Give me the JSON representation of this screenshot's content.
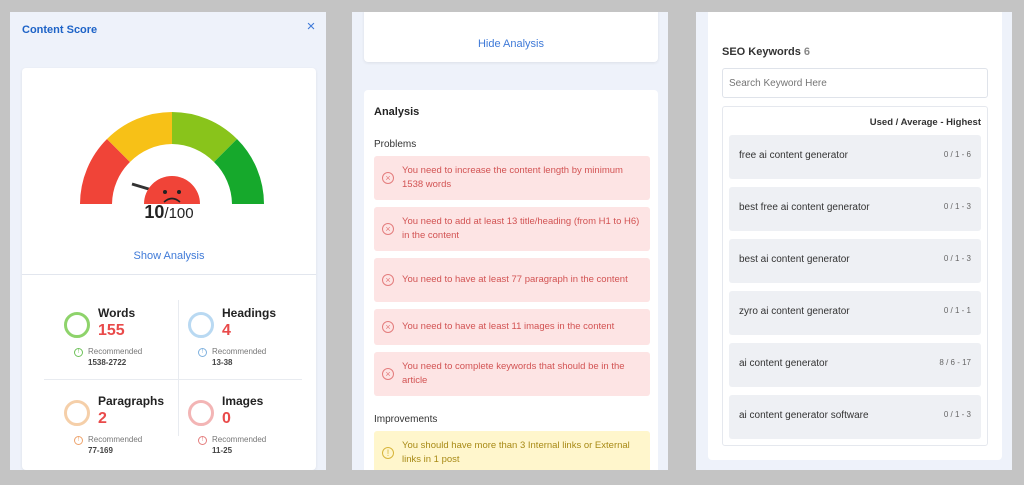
{
  "content_score": {
    "title": "Content Score",
    "close_icon": "×",
    "score": "10",
    "score_max": "/100",
    "score_fraction": 0.1,
    "face_icon": "sad-face",
    "show_analysis": "Show Analysis",
    "stats": [
      {
        "name": "Words",
        "value": "155",
        "recommended_label": "Recommended",
        "range": "1538-2722",
        "color": "#8ed36b"
      },
      {
        "name": "Headings",
        "value": "4",
        "recommended_label": "Recommended",
        "range": "13-38",
        "color": "#b9d9f2"
      },
      {
        "name": "Paragraphs",
        "value": "2",
        "recommended_label": "Recommended",
        "range": "77-169",
        "color": "#f5cfa9"
      },
      {
        "name": "Images",
        "value": "0",
        "recommended_label": "Recommended",
        "range": "11-25",
        "color": "#f3b5b5"
      }
    ],
    "colors": {
      "red": "#f04438",
      "orange": "#f7c117",
      "green_light": "#89c41b",
      "green": "#16a92c"
    }
  },
  "analysis": {
    "hide_analysis": "Hide Analysis",
    "title": "Analysis",
    "problems_label": "Problems",
    "problems": [
      "You need to increase the content length by minimum 1538 words",
      "You need to add at least 13 title/heading (from H1 to H6) in the content",
      "You need to have at least 77 paragraph in the content",
      "You need to have at least 11 images in the content",
      "You need to complete keywords that should be in the article"
    ],
    "improvements_label": "Improvements",
    "improvements": [
      "You should have more than 3 Internal links or External links in 1 post"
    ]
  },
  "seo_keywords": {
    "title": "SEO Keywords",
    "count": "6",
    "search_placeholder": "Search Keyword Here",
    "column_header": "Used / Average - Highest",
    "keywords": [
      {
        "keyword": "free ai content generator",
        "stats": "0 / 1 - 6"
      },
      {
        "keyword": "best free ai content generator",
        "stats": "0 / 1 - 3"
      },
      {
        "keyword": "best ai content generator",
        "stats": "0 / 1 - 3"
      },
      {
        "keyword": "zyro ai content generator",
        "stats": "0 / 1 - 1"
      },
      {
        "keyword": "ai content generator",
        "stats": "8 / 6 - 17"
      },
      {
        "keyword": "ai content generator software",
        "stats": "0 / 1 - 3"
      }
    ]
  }
}
